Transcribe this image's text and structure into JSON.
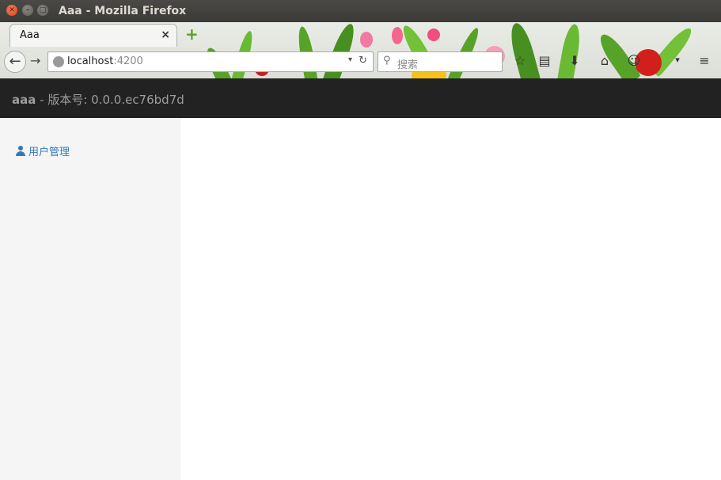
{
  "window": {
    "title": "Aaa - Mozilla Firefox"
  },
  "tab": {
    "title": "Aaa",
    "close": "×",
    "new_tab": "+"
  },
  "urlbar": {
    "host": "localhost",
    "port": ":4200",
    "drop": "▾",
    "reload": "↻"
  },
  "search": {
    "placeholder": "搜索"
  },
  "app": {
    "name": "aaa",
    "separator": " - ",
    "version": "版本号: 0.0.0.ec76bd7d"
  },
  "sidebar": {
    "items": [
      {
        "label": "用户管理",
        "icon": "user-icon"
      }
    ]
  },
  "colors": {
    "appbar_bg": "#222222",
    "link": "#337ab7",
    "sidebar_bg": "#f5f5f5"
  }
}
